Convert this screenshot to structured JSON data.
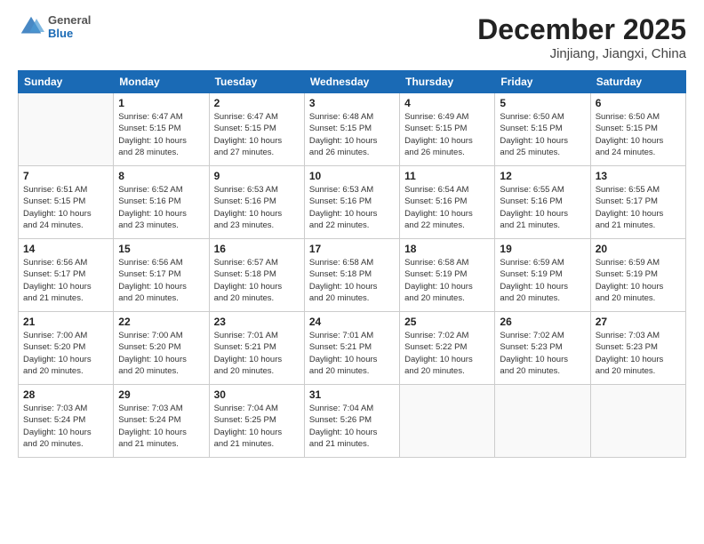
{
  "logo": {
    "general": "General",
    "blue": "Blue"
  },
  "title": "December 2025",
  "location": "Jinjiang, Jiangxi, China",
  "weekdays": [
    "Sunday",
    "Monday",
    "Tuesday",
    "Wednesday",
    "Thursday",
    "Friday",
    "Saturday"
  ],
  "weeks": [
    [
      {
        "day": "",
        "info": ""
      },
      {
        "day": "1",
        "info": "Sunrise: 6:47 AM\nSunset: 5:15 PM\nDaylight: 10 hours\nand 28 minutes."
      },
      {
        "day": "2",
        "info": "Sunrise: 6:47 AM\nSunset: 5:15 PM\nDaylight: 10 hours\nand 27 minutes."
      },
      {
        "day": "3",
        "info": "Sunrise: 6:48 AM\nSunset: 5:15 PM\nDaylight: 10 hours\nand 26 minutes."
      },
      {
        "day": "4",
        "info": "Sunrise: 6:49 AM\nSunset: 5:15 PM\nDaylight: 10 hours\nand 26 minutes."
      },
      {
        "day": "5",
        "info": "Sunrise: 6:50 AM\nSunset: 5:15 PM\nDaylight: 10 hours\nand 25 minutes."
      },
      {
        "day": "6",
        "info": "Sunrise: 6:50 AM\nSunset: 5:15 PM\nDaylight: 10 hours\nand 24 minutes."
      }
    ],
    [
      {
        "day": "7",
        "info": "Sunrise: 6:51 AM\nSunset: 5:15 PM\nDaylight: 10 hours\nand 24 minutes."
      },
      {
        "day": "8",
        "info": "Sunrise: 6:52 AM\nSunset: 5:16 PM\nDaylight: 10 hours\nand 23 minutes."
      },
      {
        "day": "9",
        "info": "Sunrise: 6:53 AM\nSunset: 5:16 PM\nDaylight: 10 hours\nand 23 minutes."
      },
      {
        "day": "10",
        "info": "Sunrise: 6:53 AM\nSunset: 5:16 PM\nDaylight: 10 hours\nand 22 minutes."
      },
      {
        "day": "11",
        "info": "Sunrise: 6:54 AM\nSunset: 5:16 PM\nDaylight: 10 hours\nand 22 minutes."
      },
      {
        "day": "12",
        "info": "Sunrise: 6:55 AM\nSunset: 5:16 PM\nDaylight: 10 hours\nand 21 minutes."
      },
      {
        "day": "13",
        "info": "Sunrise: 6:55 AM\nSunset: 5:17 PM\nDaylight: 10 hours\nand 21 minutes."
      }
    ],
    [
      {
        "day": "14",
        "info": "Sunrise: 6:56 AM\nSunset: 5:17 PM\nDaylight: 10 hours\nand 21 minutes."
      },
      {
        "day": "15",
        "info": "Sunrise: 6:56 AM\nSunset: 5:17 PM\nDaylight: 10 hours\nand 20 minutes."
      },
      {
        "day": "16",
        "info": "Sunrise: 6:57 AM\nSunset: 5:18 PM\nDaylight: 10 hours\nand 20 minutes."
      },
      {
        "day": "17",
        "info": "Sunrise: 6:58 AM\nSunset: 5:18 PM\nDaylight: 10 hours\nand 20 minutes."
      },
      {
        "day": "18",
        "info": "Sunrise: 6:58 AM\nSunset: 5:19 PM\nDaylight: 10 hours\nand 20 minutes."
      },
      {
        "day": "19",
        "info": "Sunrise: 6:59 AM\nSunset: 5:19 PM\nDaylight: 10 hours\nand 20 minutes."
      },
      {
        "day": "20",
        "info": "Sunrise: 6:59 AM\nSunset: 5:19 PM\nDaylight: 10 hours\nand 20 minutes."
      }
    ],
    [
      {
        "day": "21",
        "info": "Sunrise: 7:00 AM\nSunset: 5:20 PM\nDaylight: 10 hours\nand 20 minutes."
      },
      {
        "day": "22",
        "info": "Sunrise: 7:00 AM\nSunset: 5:20 PM\nDaylight: 10 hours\nand 20 minutes."
      },
      {
        "day": "23",
        "info": "Sunrise: 7:01 AM\nSunset: 5:21 PM\nDaylight: 10 hours\nand 20 minutes."
      },
      {
        "day": "24",
        "info": "Sunrise: 7:01 AM\nSunset: 5:21 PM\nDaylight: 10 hours\nand 20 minutes."
      },
      {
        "day": "25",
        "info": "Sunrise: 7:02 AM\nSunset: 5:22 PM\nDaylight: 10 hours\nand 20 minutes."
      },
      {
        "day": "26",
        "info": "Sunrise: 7:02 AM\nSunset: 5:23 PM\nDaylight: 10 hours\nand 20 minutes."
      },
      {
        "day": "27",
        "info": "Sunrise: 7:03 AM\nSunset: 5:23 PM\nDaylight: 10 hours\nand 20 minutes."
      }
    ],
    [
      {
        "day": "28",
        "info": "Sunrise: 7:03 AM\nSunset: 5:24 PM\nDaylight: 10 hours\nand 20 minutes."
      },
      {
        "day": "29",
        "info": "Sunrise: 7:03 AM\nSunset: 5:24 PM\nDaylight: 10 hours\nand 21 minutes."
      },
      {
        "day": "30",
        "info": "Sunrise: 7:04 AM\nSunset: 5:25 PM\nDaylight: 10 hours\nand 21 minutes."
      },
      {
        "day": "31",
        "info": "Sunrise: 7:04 AM\nSunset: 5:26 PM\nDaylight: 10 hours\nand 21 minutes."
      },
      {
        "day": "",
        "info": ""
      },
      {
        "day": "",
        "info": ""
      },
      {
        "day": "",
        "info": ""
      }
    ]
  ]
}
